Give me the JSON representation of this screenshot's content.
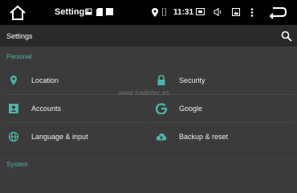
{
  "status_bar": {
    "app_title": "Settings",
    "time": "11:31",
    "icons": [
      "home-icon",
      "sd-card-icon",
      "sim-icon",
      "square-icon",
      "location-icon",
      "vibrate-icon",
      "screenshot-icon",
      "volume-icon",
      "image-icon",
      "overflow-menu-icon",
      "back-icon"
    ]
  },
  "toolbar": {
    "title": "Settings"
  },
  "sections": {
    "personal": "Personal",
    "system": "System"
  },
  "items": {
    "location": "Location",
    "security": "Security",
    "accounts": "Accounts",
    "google": "Google",
    "language": "Language & input",
    "backup": "Backup & reset"
  },
  "watermark": "www.tradetec.es",
  "colors": {
    "accent": "#4db6ac",
    "background": "#3b3b3b",
    "toolbar": "#2a2a2a",
    "statusbar": "#000000"
  }
}
